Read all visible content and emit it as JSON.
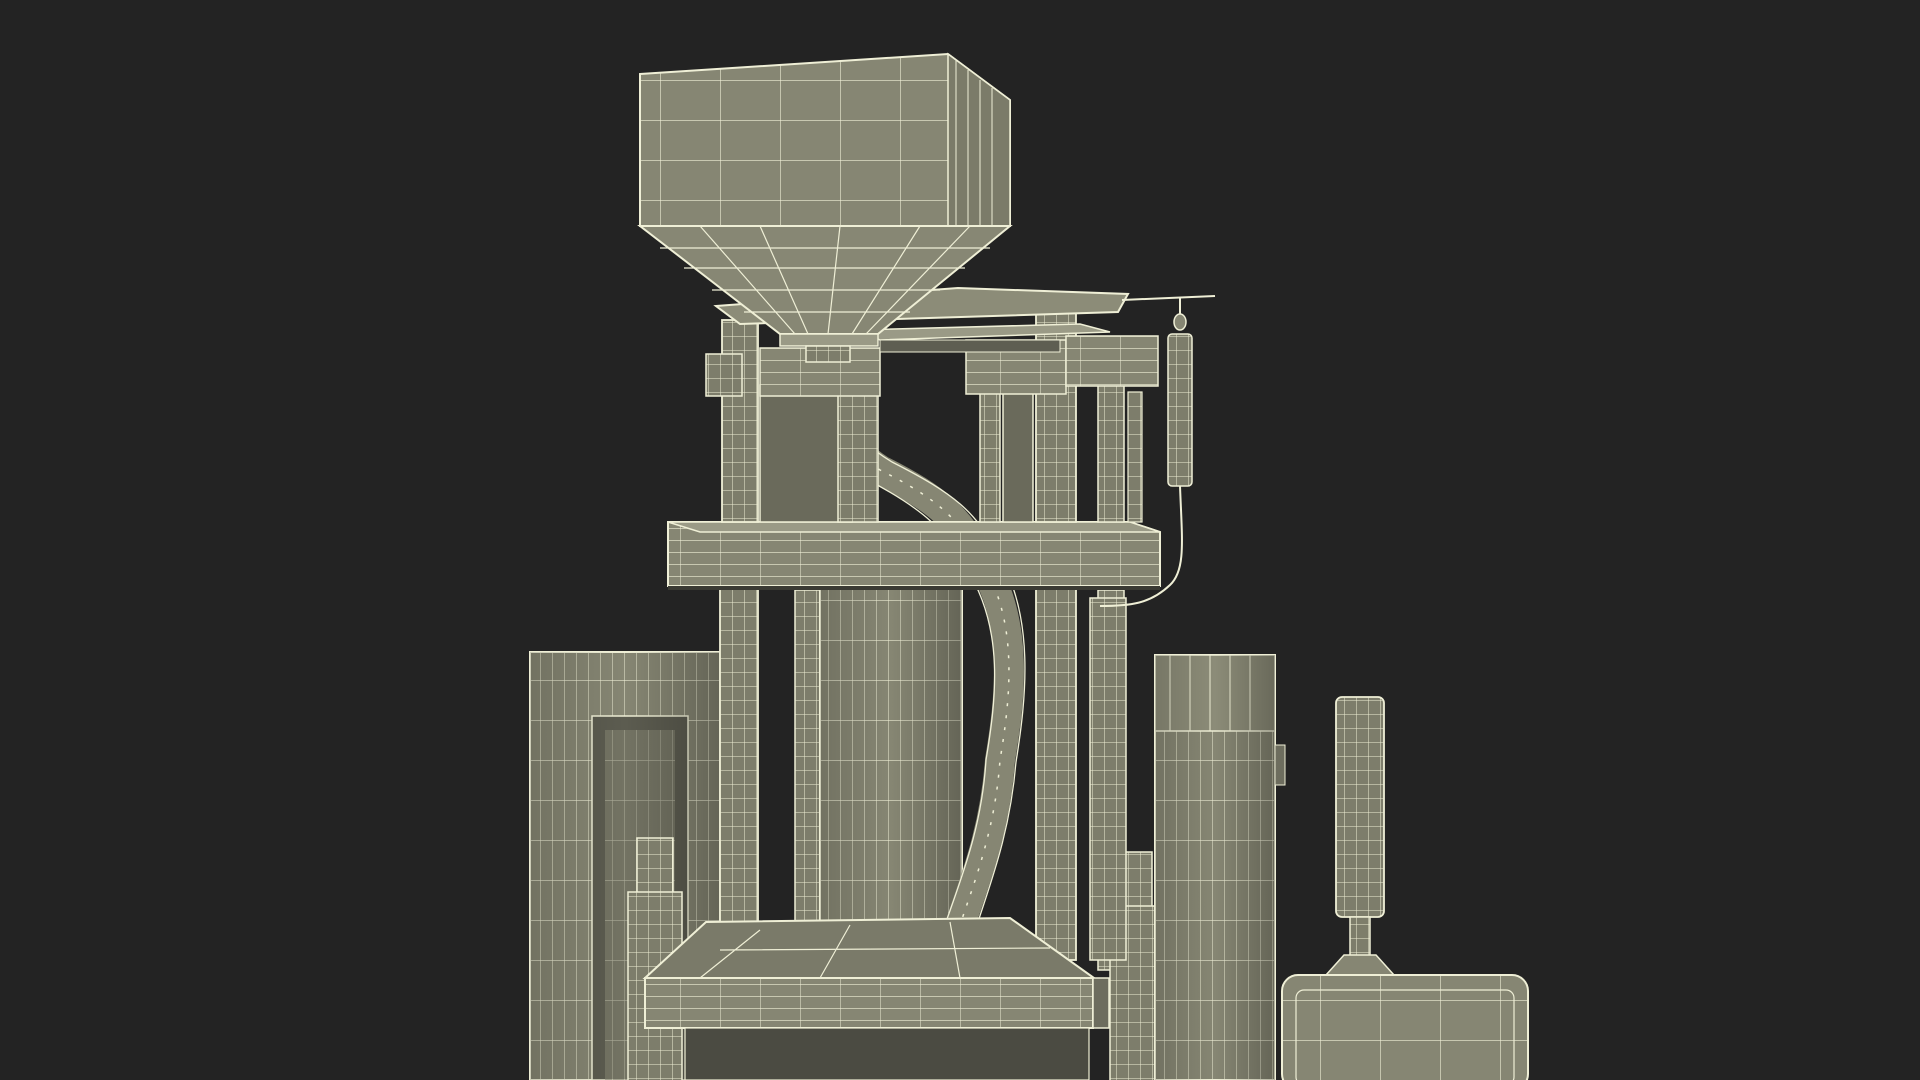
{
  "scene": {
    "colors": {
      "background": "#232323",
      "body": "#868673",
      "body_dark": "#6f6f60",
      "body_light": "#9a9a86",
      "wire": "#efefd6"
    },
    "parts": [
      "hopper",
      "feed-tube",
      "top-frame",
      "upper-columns",
      "middle-platen",
      "center-ram",
      "lower-columns",
      "base-platen",
      "left-guard-frame",
      "right-guard-frame",
      "side-cylinders",
      "sensor-rod",
      "signal-tower",
      "control-box"
    ]
  }
}
